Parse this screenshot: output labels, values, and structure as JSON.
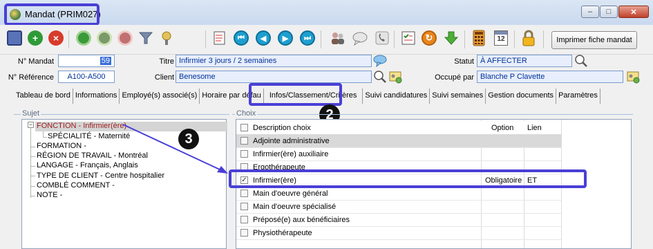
{
  "window": {
    "title": "Mandat (PRIM027)",
    "controls": {
      "minimize": "–",
      "maximize": "□",
      "close": "✕"
    }
  },
  "toolbar": {
    "print_label": "Imprimer fiche mandat",
    "icons": [
      "save-icon",
      "add-icon",
      "delete-icon",
      "search-add-icon",
      "search-tools-icon",
      "search-remove-icon",
      "filter-icon",
      "key-pin-icon",
      "notepad-icon",
      "first-icon",
      "previous-icon",
      "next-icon",
      "last-icon",
      "users-icon",
      "message-icon",
      "phone-icon",
      "checklist-icon",
      "refresh-icon",
      "download-arrow-icon",
      "calculator-icon",
      "calendar-icon",
      "lock-icon",
      "spacer-icon"
    ],
    "calendar_text": "12"
  },
  "form": {
    "no_mandat_label": "N° Mandat",
    "no_mandat_value": "59",
    "no_reference_label": "N° Référence",
    "no_reference_value": "A100-A500",
    "titre_label": "Titre",
    "titre_value": "Infirmier 3 jours / 2 semaines",
    "client_label": "Client",
    "client_value": "Benesome",
    "statut_label": "Statut",
    "statut_value": "À AFFECTER",
    "occupe_label": "Occupé par",
    "occupe_value": "Blanche P Clavette"
  },
  "tabs": [
    "Tableau de bord",
    "Informations",
    "Employé(s) associé(s)",
    "Horaire par défau",
    "Infos/Classement/Critères",
    "Suivi candidatures",
    "Suivi semaines",
    "Gestion documents",
    "Paramètres"
  ],
  "annotations": {
    "badge2": "2",
    "badge3": "3"
  },
  "sujet": {
    "label": "Sujet",
    "items": [
      "FONCTION - Infirmier(ère)",
      "SPÉCIALITÉ - Maternité",
      "FORMATION -",
      "RÉGION DE TRAVAIL - Montréal",
      "LANGAGE - Français, Anglais",
      "TYPE DE CLIENT - Centre hospitalier",
      "COMBLÉ COMMENT -",
      "NOTE -"
    ],
    "expander": "−"
  },
  "choix": {
    "label": "Choix",
    "headers": {
      "description": "Description choix",
      "option": "Option",
      "lien": "Lien"
    },
    "rows": [
      {
        "description": "Adjointe administrative",
        "option": "",
        "lien": "",
        "checked": false
      },
      {
        "description": "Infirmier(ère) auxiliaire",
        "option": "",
        "lien": "",
        "checked": false
      },
      {
        "description": "Ergothérapeute",
        "option": "",
        "lien": "",
        "checked": false
      },
      {
        "description": "Infirmier(ère)",
        "option": "Obligatoire",
        "lien": "ET",
        "checked": true
      },
      {
        "description": "Main d'oeuvre général",
        "option": "",
        "lien": "",
        "checked": false
      },
      {
        "description": "Main d'oeuvre spécialisé",
        "option": "",
        "lien": "",
        "checked": false
      },
      {
        "description": "Préposé(e) aux bénéficiaires",
        "option": "",
        "lien": "",
        "checked": false
      },
      {
        "description": "Physiothérapeute",
        "option": "",
        "lien": "",
        "checked": false
      }
    ],
    "check_mark": "✓"
  },
  "colors": {
    "annotation": "#4a3fd6",
    "selected_tree_text": "#9a1a1a",
    "field_text": "#003399"
  }
}
